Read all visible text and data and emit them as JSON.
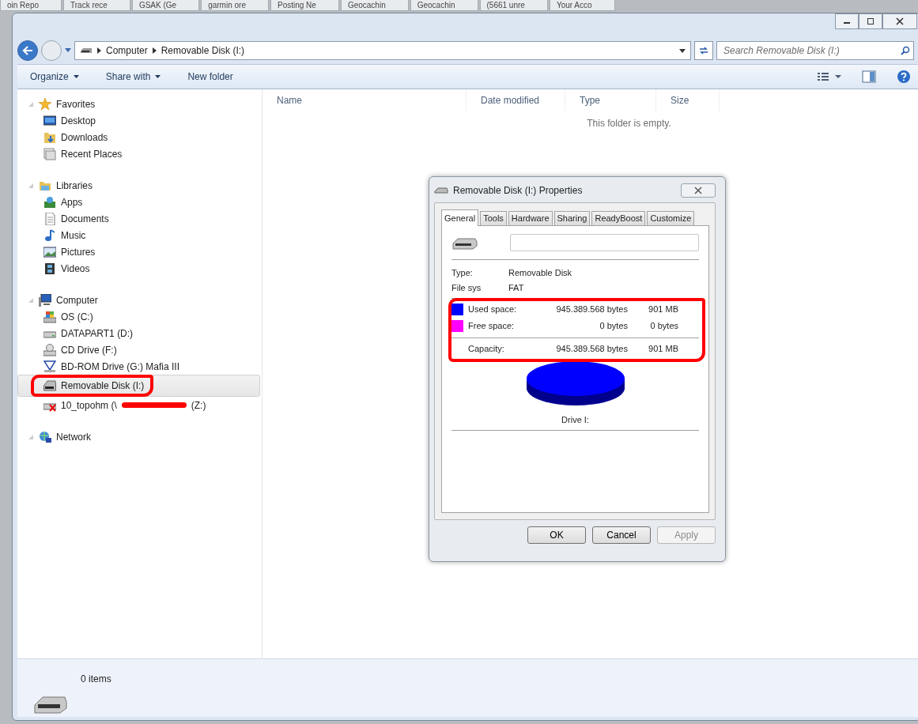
{
  "browser_tabs": [
    {
      "label": "oin Repo"
    },
    {
      "label": "Track rece"
    },
    {
      "label": "GSAK (Ge"
    },
    {
      "label": "garmin ore"
    },
    {
      "label": "Posting Ne"
    },
    {
      "label": "Geocachin"
    },
    {
      "label": "Geocachin"
    },
    {
      "label": "(5661 unre"
    },
    {
      "label": "Your Acco"
    }
  ],
  "address_bar": {
    "path": [
      "Computer",
      "Removable Disk (I:)"
    ]
  },
  "search": {
    "placeholder": "Search Removable Disk (I:)"
  },
  "toolbar": {
    "buttons": [
      {
        "label": "Organize",
        "dropdown": true
      },
      {
        "label": "Share with",
        "dropdown": true
      },
      {
        "label": "New folder",
        "dropdown": false
      }
    ]
  },
  "nav_pane": {
    "groups": [
      {
        "label": "Favorites",
        "kind": "star",
        "children": [
          {
            "label": "Desktop",
            "kind": "desktop",
            "selected": false
          },
          {
            "label": "Downloads",
            "kind": "downloads",
            "selected": false
          },
          {
            "label": "Recent Places",
            "kind": "recent",
            "selected": false
          }
        ]
      },
      {
        "label": "Libraries",
        "kind": "library",
        "children": [
          {
            "label": "Apps",
            "kind": "apps",
            "selected": false
          },
          {
            "label": "Documents",
            "kind": "document",
            "selected": false
          },
          {
            "label": "Music",
            "kind": "music",
            "selected": false
          },
          {
            "label": "Pictures",
            "kind": "picture",
            "selected": false
          },
          {
            "label": "Videos",
            "kind": "video",
            "selected": false
          }
        ]
      },
      {
        "label": "Computer",
        "kind": "computer",
        "children": [
          {
            "label": "OS (C:)",
            "kind": "osdrive",
            "selected": false
          },
          {
            "label": "DATAPART1 (D:)",
            "kind": "hdd",
            "selected": false
          },
          {
            "label": "CD Drive (F:)",
            "kind": "cd",
            "selected": false
          },
          {
            "label": "BD-ROM Drive (G:) Mafia III",
            "kind": "bd",
            "selected": false
          },
          {
            "label": "Removable Disk (I:)",
            "kind": "usb",
            "selected": true,
            "marked": true
          },
          {
            "label": "10_topohm (\\",
            "label_end": "(Z:)",
            "kind": "netdrive",
            "selected": false
          }
        ]
      },
      {
        "label": "Network",
        "kind": "network"
      }
    ]
  },
  "columns": [
    "Name",
    "Date modified",
    "Type",
    "Size"
  ],
  "empty_message": "This folder is empty.",
  "status_bar": {
    "text": "0 items"
  },
  "dialog": {
    "title": "Removable Disk (I:) Properties",
    "tabs": [
      {
        "label": "General",
        "selected": true
      },
      {
        "label": "Tools",
        "selected": false
      },
      {
        "label": "Hardware",
        "selected": false
      },
      {
        "label": "Sharing",
        "selected": false
      },
      {
        "label": "ReadyBoost",
        "selected": false
      },
      {
        "label": "Customize",
        "selected": false
      }
    ],
    "type_label": "Type:",
    "type_value": "Removable Disk",
    "fs_label": "File sys",
    "fs_value": "FAT",
    "space": [
      {
        "label": "Used space:",
        "bytes": "945.389.568 bytes",
        "size": "901 MB",
        "color": "#0000ff"
      },
      {
        "label": "Free space:",
        "bytes": "0 bytes",
        "size": "0 bytes",
        "color": "#ff00ff"
      }
    ],
    "space_marked": true,
    "capacity": {
      "label": "Capacity:",
      "bytes": "945.389.568 bytes",
      "size": "901 MB"
    },
    "drive_label": "Drive I:",
    "buttons": [
      {
        "label": "OK",
        "disabled": false
      },
      {
        "label": "Cancel",
        "disabled": false
      },
      {
        "label": "Apply",
        "disabled": true
      }
    ]
  }
}
